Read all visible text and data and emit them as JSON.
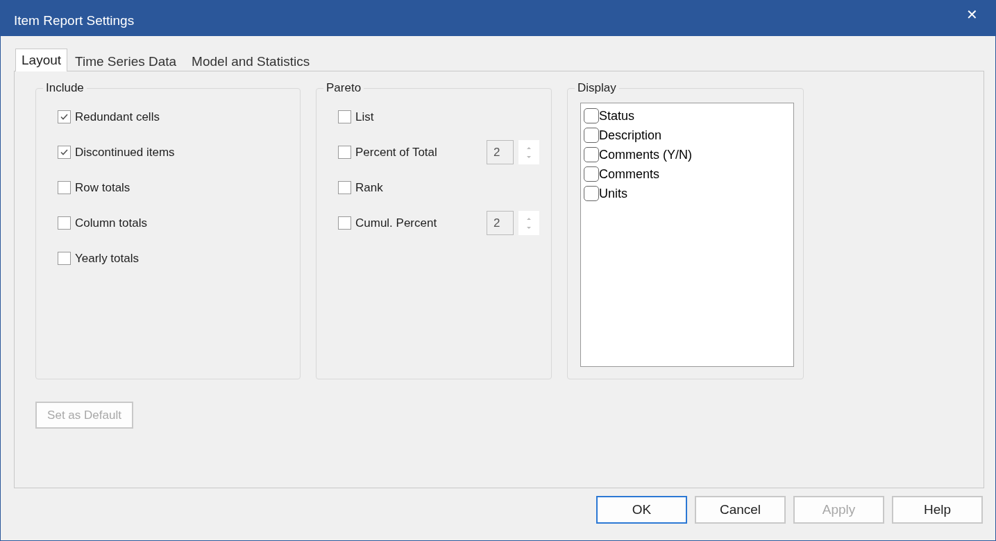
{
  "window": {
    "title": "Item Report Settings",
    "close": "✕"
  },
  "tabs": [
    {
      "label": "Layout",
      "selected": true
    },
    {
      "label": "Time Series Data",
      "selected": false
    },
    {
      "label": "Model and Statistics",
      "selected": false
    }
  ],
  "include": {
    "title": "Include",
    "items": [
      {
        "label": "Redundant cells",
        "checked": true
      },
      {
        "label": "Discontinued items",
        "checked": true
      },
      {
        "label": "Row totals",
        "checked": false
      },
      {
        "label": "Column totals",
        "checked": false
      },
      {
        "label": "Yearly totals",
        "checked": false
      }
    ]
  },
  "pareto": {
    "title": "Pareto",
    "items": [
      {
        "kind": "checkbox",
        "label": "List",
        "checked": false
      },
      {
        "kind": "spin",
        "label": "Percent of Total",
        "checked": false,
        "value": "2"
      },
      {
        "kind": "checkbox",
        "label": "Rank",
        "checked": false
      },
      {
        "kind": "spin",
        "label": "Cumul. Percent",
        "checked": false,
        "value": "2"
      }
    ]
  },
  "display": {
    "title": "Display",
    "items": [
      {
        "label": "Status",
        "checked": false
      },
      {
        "label": "Description",
        "checked": false
      },
      {
        "label": "Comments (Y/N)",
        "checked": false
      },
      {
        "label": "Comments",
        "checked": false
      },
      {
        "label": "Units",
        "checked": false
      }
    ]
  },
  "set_default": {
    "label": "Set as Default",
    "disabled": true
  },
  "buttons": [
    {
      "label": "OK",
      "default": true,
      "disabled": false
    },
    {
      "label": "Cancel",
      "default": false,
      "disabled": false
    },
    {
      "label": "Apply",
      "default": false,
      "disabled": true
    },
    {
      "label": "Help",
      "default": false,
      "disabled": false
    }
  ]
}
